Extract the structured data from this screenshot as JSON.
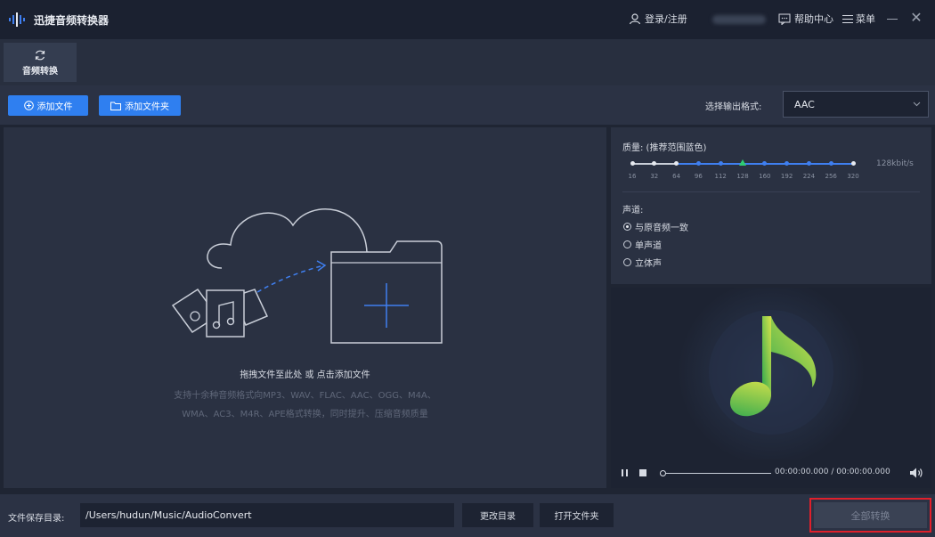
{
  "app": {
    "title": "迅捷音频转换器",
    "login": "登录/注册",
    "help": "帮助中心",
    "menu": "菜单"
  },
  "tabs": [
    {
      "label": "音频转换",
      "icon": "refresh-icon",
      "active": true
    }
  ],
  "toolbar": {
    "add_file": "添加文件",
    "add_folder": "添加文件夹",
    "format_label": "选择输出格式:",
    "format_value": "AAC"
  },
  "dropzone": {
    "hint": "拖拽文件至此处 或 点击添加文件",
    "desc_line1": "支持十余种音频格式向MP3、WAV、FLAC、AAC、OGG、M4A、",
    "desc_line2": "WMA、AC3、M4R、APE格式转换，同时提升、压缩音频质量"
  },
  "settings": {
    "quality_label": "质量: (推荐范围蓝色)",
    "quality_ticks": [
      "16",
      "32",
      "64",
      "96",
      "112",
      "128",
      "160",
      "192",
      "224",
      "256",
      "320"
    ],
    "quality_selected": "128",
    "quality_value": "128kbit/s",
    "channel_label": "声道:",
    "channels": [
      {
        "label": "与原音频一致",
        "checked": true
      },
      {
        "label": "单声道",
        "checked": false
      },
      {
        "label": "立体声",
        "checked": false
      }
    ]
  },
  "player": {
    "time": "00:00:00.000 / 00:00:00.000",
    "progress": 0
  },
  "footer": {
    "save_label": "文件保存目录:",
    "save_path": "/Users/hudun/Music/AudioConvert",
    "change_dir": "更改目录",
    "open_folder": "打开文件夹",
    "convert_all": "全部转换"
  },
  "colors": {
    "accent": "#2f7ff0",
    "selected_tick": "#2ecc71",
    "highlight_border": "#e0202b",
    "note_gradient_start": "#2ea84f",
    "note_gradient_end": "#d8e34a"
  }
}
